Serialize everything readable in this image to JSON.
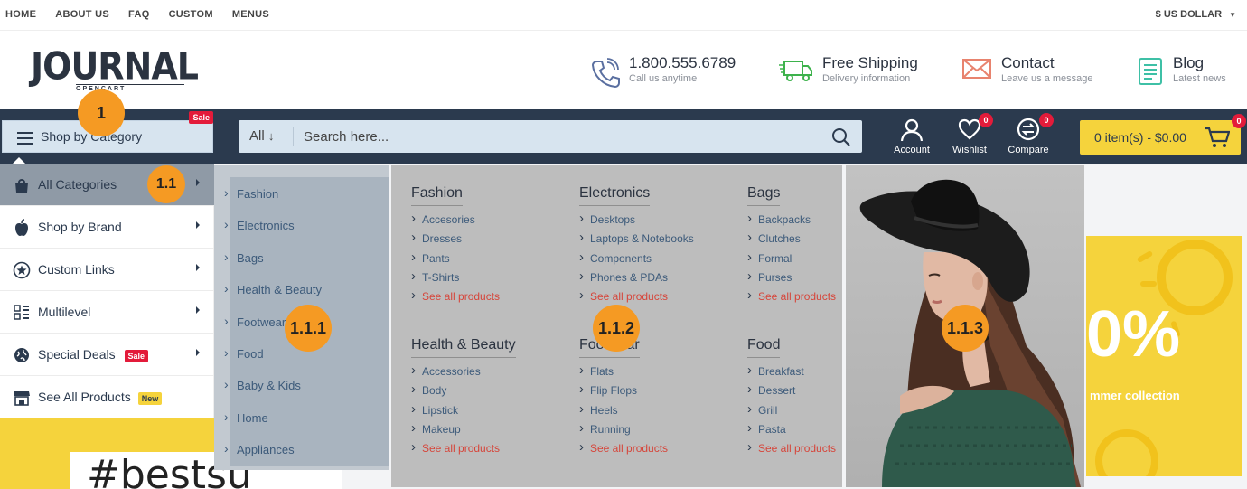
{
  "topbar": {
    "links": [
      "HOME",
      "ABOUT US",
      "FAQ",
      "CUSTOM",
      "MENUS"
    ],
    "currency": "$ US DOLLAR"
  },
  "logo": {
    "word": "JOURNAL",
    "sub": "OPENCART"
  },
  "header_items": [
    {
      "icon": "phone-icon",
      "title": "1.800.555.6789",
      "sub": "Call us anytime"
    },
    {
      "icon": "truck-icon",
      "title": "Free Shipping",
      "sub": "Delivery information"
    },
    {
      "icon": "envelope-icon",
      "title": "Contact",
      "sub": "Leave us a message"
    },
    {
      "icon": "document-icon",
      "title": "Blog",
      "sub": "Latest news"
    }
  ],
  "nav": {
    "shop_by_category": "Shop by Category",
    "sale_badge": "Sale",
    "search_scope": "All",
    "search_placeholder": "Search here...",
    "account": "Account",
    "wishlist": "Wishlist",
    "wishlist_count": "0",
    "compare": "Compare",
    "compare_count": "0",
    "cart": "0 item(s) - $0.00",
    "cart_count": "0"
  },
  "dropdown": {
    "items": [
      {
        "label": "All Categories",
        "icon": "shopping-bag-icon"
      },
      {
        "label": "Shop by Brand",
        "icon": "apple-icon"
      },
      {
        "label": "Custom Links",
        "icon": "star-circle-icon"
      },
      {
        "label": "Multilevel",
        "icon": "grid-icon"
      },
      {
        "label": "Special Deals",
        "icon": "globe-icon",
        "badge": "Sale"
      },
      {
        "label": "See All Products",
        "icon": "store-icon",
        "badge": "New"
      }
    ]
  },
  "subcategories": [
    "Fashion",
    "Electronics",
    "Bags",
    "Health & Beauty",
    "Footwear",
    "Food",
    "Baby & Kids",
    "Home",
    "Appliances"
  ],
  "mega": [
    {
      "title": "Fashion",
      "links": [
        "Accesories",
        "Dresses",
        "Pants",
        "T-Shirts"
      ],
      "see_all": "See all products"
    },
    {
      "title": "Electronics",
      "links": [
        "Desktops",
        "Laptops & Notebooks",
        "Components",
        "Phones & PDAs"
      ],
      "see_all": "See all products"
    },
    {
      "title": "Bags",
      "links": [
        "Backpacks",
        "Clutches",
        "Formal",
        "Purses"
      ],
      "see_all": "See all products"
    },
    {
      "title": "Health & Beauty",
      "links": [
        "Accessories",
        "Body",
        "Lipstick",
        "Makeup"
      ],
      "see_all": "See all products"
    },
    {
      "title": "Footwear",
      "links": [
        "Flats",
        "Flip Flops",
        "Heels",
        "Running"
      ],
      "see_all": "See all products"
    },
    {
      "title": "Food",
      "links": [
        "Breakfast",
        "Dessert",
        "Grill",
        "Pasta"
      ],
      "see_all": "See all products"
    }
  ],
  "promo": {
    "percent": "0%",
    "text": "mmer collection"
  },
  "banner": {
    "text": "#bestsu"
  },
  "callouts": [
    "1",
    "1.1",
    "1.1.1",
    "1.1.2",
    "1.1.3"
  ],
  "colors": {
    "navy": "#2b3a4e",
    "yellow": "#f5d33c",
    "sale_red": "#e31b3a",
    "callout_orange": "#f59a23"
  }
}
